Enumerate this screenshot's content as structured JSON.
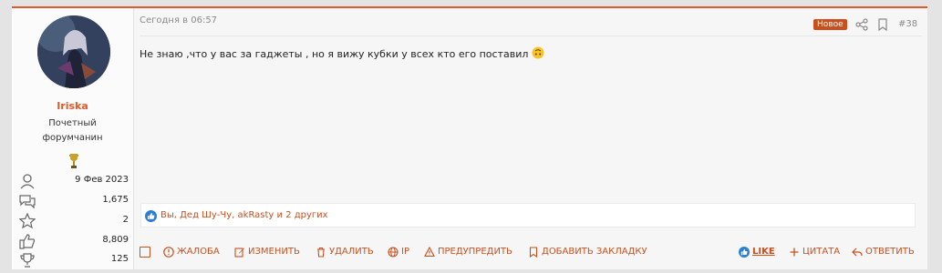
{
  "user": {
    "name": "Iriska",
    "title_line1": "Почетный",
    "title_line2": "форумчанин",
    "stats": [
      {
        "icon": "user-icon",
        "value": "9 Фев 2023"
      },
      {
        "icon": "messages-icon",
        "value": "1,675"
      },
      {
        "icon": "star-icon",
        "value": "2"
      },
      {
        "icon": "thumbs-up-icon",
        "value": "8,809"
      },
      {
        "icon": "trophy-icon",
        "value": "125"
      }
    ]
  },
  "post": {
    "date": "Сегодня в 06:57",
    "badge": "Новое",
    "number": "#38",
    "message": "Не знаю ,что у вас за гаджеты , но я вижу кубки у всех кто его поставил",
    "reactions": "Вы, Дед Шу-Чу, akRasty и 2 других"
  },
  "actions": {
    "report": "ЖАЛОБА",
    "edit": "ИЗМЕНИТЬ",
    "delete": "УДАЛИТЬ",
    "ip": "IP",
    "warn": "ПРЕДУПРЕДИТЬ",
    "bookmark": "ДОБАВИТЬ ЗАКЛАДКУ",
    "like": "LIKE",
    "quote": "ЦИТАТА",
    "reply": "ОТВЕТИТЬ"
  },
  "colors": {
    "accent": "#c8501f",
    "top_border": "#e05a2b",
    "badge_bg": "#c8501f",
    "like_blue": "#2a7fd8"
  }
}
